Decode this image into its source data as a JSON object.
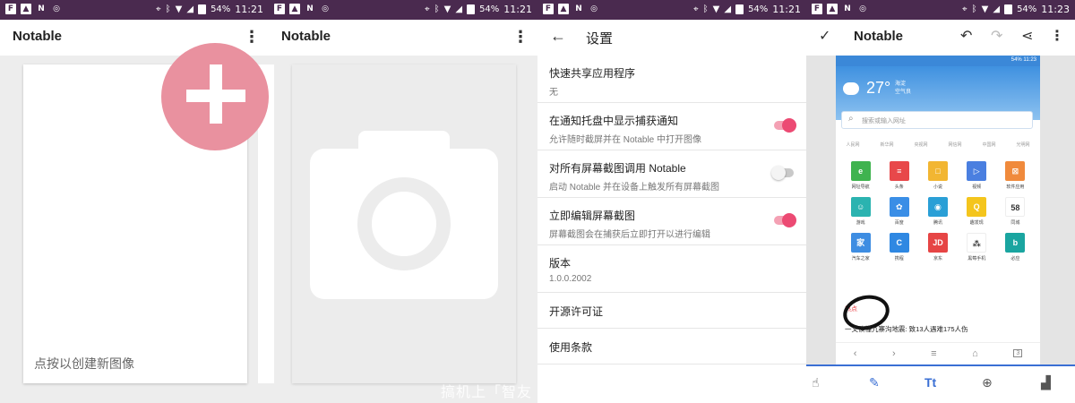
{
  "status_bar": {
    "battery": "54%",
    "time1": "11:21",
    "time2": "11:21",
    "time3": "11:21",
    "time4": "11:23"
  },
  "app_title": "Notable",
  "home": {
    "create_hint": "点按以创建新图像"
  },
  "watermark": "搞机上「智友",
  "settings": {
    "title": "设置",
    "items": [
      {
        "title": "快速共享应用程序",
        "sub": "无"
      },
      {
        "title": "在通知托盘中显示捕获通知",
        "sub": "允许随时截屏并在 Notable 中打开图像",
        "toggle": "on"
      },
      {
        "title": "对所有屏幕截图调用 Notable",
        "sub": "启动 Notable 并在设备上触发所有屏幕截图",
        "toggle": "off"
      },
      {
        "title": "立即编辑屏幕截图",
        "sub": "屏幕截图会在捕获后立即打开以进行编辑",
        "toggle": "on"
      },
      {
        "title": "版本",
        "sub": "1.0.0.2002"
      },
      {
        "title": "开源许可证"
      },
      {
        "title": "使用条款"
      }
    ]
  },
  "editor": {
    "title": "Notable",
    "shot": {
      "status_time": "11:23",
      "status_battery": "54%",
      "temperature": "27°",
      "location": "海淀",
      "air": "空气良",
      "search_placeholder": "搜索或输入网址",
      "tabs": [
        "人民网",
        "新华网",
        "央视网",
        "网信网",
        "中国网",
        "光明网"
      ],
      "apps": [
        {
          "label": "网址导航",
          "color": "#3fb34f",
          "glyph": "e"
        },
        {
          "label": "头条",
          "color": "#e8484a",
          "glyph": "≡"
        },
        {
          "label": "小说",
          "color": "#f2b632",
          "glyph": "□"
        },
        {
          "label": "视频",
          "color": "#4a7fe0",
          "glyph": "▷"
        },
        {
          "label": "软件应用",
          "color": "#f08a3c",
          "glyph": "⊠"
        },
        {
          "label": "游戏",
          "color": "#2bb3b0",
          "glyph": "☺"
        },
        {
          "label": "百度",
          "color": "#3a8ee6",
          "glyph": "✿"
        },
        {
          "label": "腾讯",
          "color": "#2a9fd6",
          "glyph": "◉"
        },
        {
          "label": "趣发现",
          "color": "#f4c51d",
          "glyph": "Q"
        },
        {
          "label": "同城",
          "color": "#ffffff",
          "glyph": "58"
        },
        {
          "label": "汽车之家",
          "color": "#3e8de2",
          "glyph": "家"
        },
        {
          "label": "携程",
          "color": "#2f88e2",
          "glyph": "C"
        },
        {
          "label": "京东",
          "color": "#e64545",
          "glyph": "JD"
        },
        {
          "label": "黑莓手机",
          "color": "#ffffff",
          "glyph": "⁂"
        },
        {
          "label": "必应",
          "color": "#1aa5a0",
          "glyph": "b"
        }
      ],
      "hot_label": "热点",
      "news": "一文读懂九寨沟地震: 致13人遇难175人伤",
      "nav_page": "3"
    },
    "tool_text": "Tt"
  }
}
